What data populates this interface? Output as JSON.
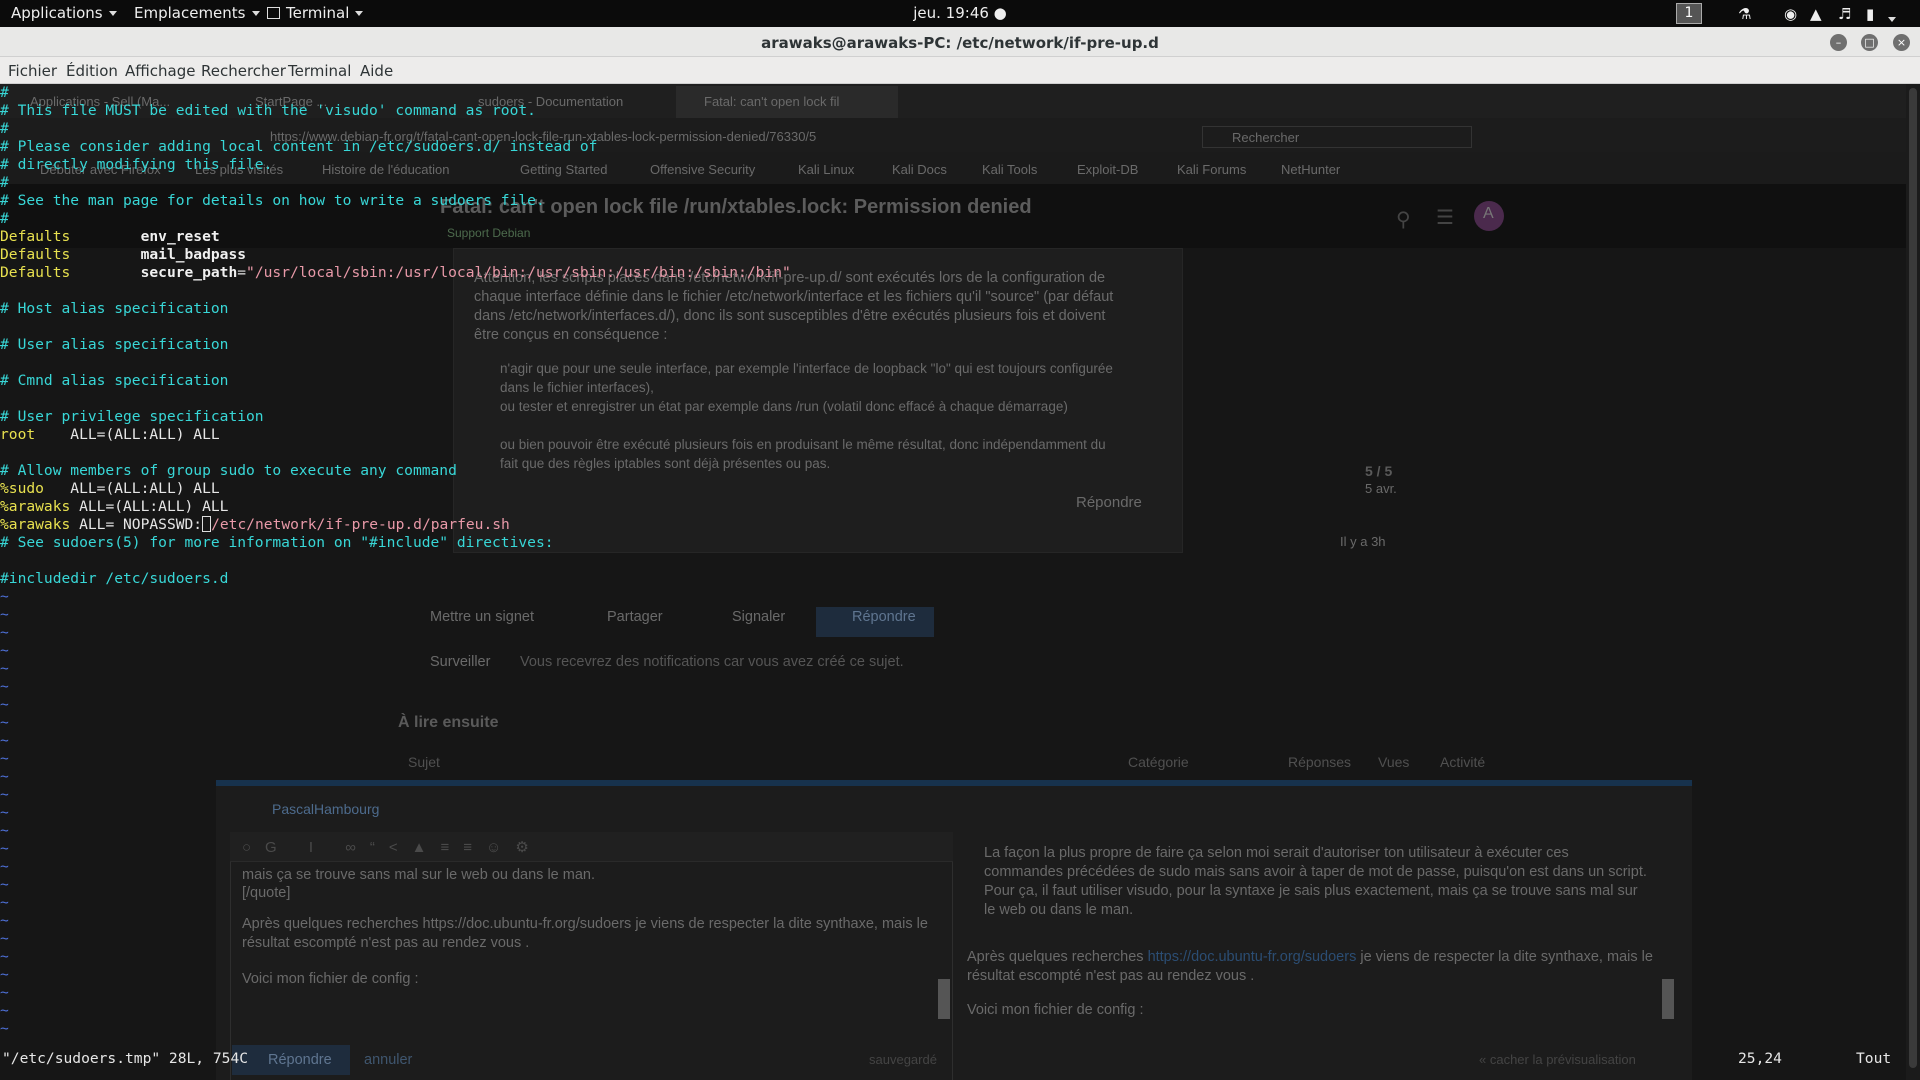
{
  "topbar": {
    "applications": "Applications",
    "places": "Emplacements",
    "terminal": "Terminal",
    "clock": "jeu. 19:46 ●",
    "workspace": "1",
    "icons": [
      "people-icon",
      "record-icon",
      "wifi-icon",
      "volume-icon",
      "battery-icon",
      "menu-caret-icon"
    ]
  },
  "window": {
    "title": "arawaks@arawaks-PC: /etc/network/if-pre-up.d",
    "menu": [
      "Fichier",
      "Édition",
      "Affichage",
      "Rechercher",
      "Terminal",
      "Aide"
    ]
  },
  "vim": {
    "lines": [
      [
        {
          "c": "cm",
          "t": "#"
        }
      ],
      [
        {
          "c": "cm",
          "t": "# This file MUST be edited with the 'visudo' command as root."
        }
      ],
      [
        {
          "c": "cm",
          "t": "#"
        }
      ],
      [
        {
          "c": "cm",
          "t": "# Please consider adding local content in /etc/sudoers.d/ instead of"
        }
      ],
      [
        {
          "c": "cm",
          "t": "# directly modifying this file."
        }
      ],
      [
        {
          "c": "cm",
          "t": "#"
        }
      ],
      [
        {
          "c": "cm",
          "t": "# See the man page for details on how to write a sudoers file."
        }
      ],
      [
        {
          "c": "cm",
          "t": "#"
        }
      ],
      [
        {
          "c": "kw",
          "t": "Defaults"
        },
        {
          "c": "",
          "t": "        "
        },
        {
          "c": "id",
          "t": "env_reset"
        }
      ],
      [
        {
          "c": "kw",
          "t": "Defaults"
        },
        {
          "c": "",
          "t": "        "
        },
        {
          "c": "id",
          "t": "mail_badpass"
        }
      ],
      [
        {
          "c": "kw",
          "t": "Defaults"
        },
        {
          "c": "",
          "t": "        "
        },
        {
          "c": "id",
          "t": "secure_path"
        },
        {
          "c": "",
          "t": "="
        },
        {
          "c": "st",
          "t": "\"/usr/local/sbin:/usr/local/bin:/usr/sbin:/usr/bin:/sbin:/bin\""
        }
      ],
      [
        {
          "c": "",
          "t": ""
        }
      ],
      [
        {
          "c": "cm",
          "t": "# Host alias specification"
        }
      ],
      [
        {
          "c": "",
          "t": ""
        }
      ],
      [
        {
          "c": "cm",
          "t": "# User alias specification"
        }
      ],
      [
        {
          "c": "",
          "t": ""
        }
      ],
      [
        {
          "c": "cm",
          "t": "# Cmnd alias specification"
        }
      ],
      [
        {
          "c": "",
          "t": ""
        }
      ],
      [
        {
          "c": "cm",
          "t": "# User privilege specification"
        }
      ],
      [
        {
          "c": "ps",
          "t": "root"
        },
        {
          "c": "",
          "t": "    ALL=(ALL:ALL) ALL"
        }
      ],
      [
        {
          "c": "",
          "t": ""
        }
      ],
      [
        {
          "c": "cm",
          "t": "# Allow members of group sudo to execute any command"
        }
      ],
      [
        {
          "c": "ps",
          "t": "%sudo"
        },
        {
          "c": "",
          "t": "   ALL=(ALL:ALL) ALL"
        }
      ],
      [
        {
          "c": "ps",
          "t": "%arawaks"
        },
        {
          "c": "",
          "t": " ALL=(ALL:ALL) ALL"
        }
      ],
      [
        {
          "c": "ps",
          "t": "%arawaks"
        },
        {
          "c": "",
          "t": " ALL= NOPASSWD:"
        },
        {
          "c": "cursor",
          "t": ""
        },
        {
          "c": "st",
          "t": "/etc/network/if-pre-up.d/parfeu.sh"
        }
      ],
      [
        {
          "c": "cm",
          "t": "# See sudoers(5) for more information on \"#include\" directives:"
        }
      ],
      [
        {
          "c": "",
          "t": ""
        }
      ],
      [
        {
          "c": "cm",
          "t": "#includedir /etc/sudoers.d"
        }
      ]
    ],
    "tilde": "~",
    "tilde_count": 25,
    "status_file": "\"/etc/sudoers.tmp\" 28L, 754C",
    "status_pos": "25,24",
    "status_scroll": "Tout"
  },
  "ghost": {
    "tabs": [
      "Applications - Sell (Ma...",
      "StartPage ...",
      "sudoers - Documentation",
      "Fatal: can't open lock fil"
    ],
    "url": "https://www.debian-fr.org/t/fatal-cant-open-lock-file-run-xtables-lock-permission-denied/76330/5",
    "search_placeholder": "Rechercher",
    "bookmarks": [
      "Débuter avec Firefox",
      "Les plus visités",
      "Histoire de l'éducation",
      "Getting Started",
      "Offensive Security",
      "Kali Linux",
      "Kali Docs",
      "Kali Tools",
      "Exploit-DB",
      "Kali Forums",
      "NetHunter"
    ],
    "topic_title": "Fatal: can't open lock file /run/xtables.lock: Permission denied",
    "category": "Support Debian",
    "avatar_letter": "A",
    "post_paragraph": "Attention, les scripts placés dans /etc/network/if-pre-up.d/ sont exécutés lors de la configuration de chaque interface définie dans le fichier /etc/network/interface et les fichiers qu'il \"source\" (par défaut dans /etc/network/interfaces.d/), donc ils sont susceptibles d'être exécutés plusieurs fois et doivent être conçus en conséquence :",
    "bullets": [
      "n'agir que pour une seule interface, par exemple l'interface de loopback \"lo\" qui est toujours configurée dans le fichier interfaces),",
      "ou tester et enregistrer un état par exemple dans /run (volatil donc effacé à chaque démarrage)",
      "ou bien pouvoir être exécuté plusieurs fois en produisant le même résultat, donc indépendamment du fait que des règles iptables sont déjà présentes ou pas."
    ],
    "reply_label": "Répondre",
    "progress": "5 / 5",
    "progress_date": "5 avr.",
    "ago": "Il y a 3h",
    "actions": [
      "Mettre un signet",
      "Partager",
      "Signaler",
      "Répondre"
    ],
    "watch_label": "Surveiller",
    "watch_text": "Vous recevrez des notifications car vous avez créé ce sujet.",
    "next_heading": "À lire ensuite",
    "next_cols": [
      "Sujet",
      "Catégorie",
      "Réponses",
      "Vues",
      "Activité"
    ],
    "compose_user": "PascalHambourg",
    "compose_lines": [
      "mais ça se trouve sans mal sur le web ou dans le man.",
      "[/quote]",
      "",
      " Après quelques recherches https://doc.ubuntu-fr.org/sudoers je viens de respecter la dite synthaxe, mais le résultat escompté n'est pas au rendez vous .",
      "",
      "Voici mon fichier de config :"
    ],
    "preview_quote": "La façon la plus propre de faire ça selon moi serait d'autoriser ton utilisateur à exécuter ces commandes précédées de sudo mais sans avoir à taper de mot de passe, puisqu'on est dans un script. Pour ça, il faut utiliser visudo, pour la syntaxe je sais plus exactement, mais ça se trouve sans mal sur le web ou dans le man.",
    "preview_p1_pre": "Après quelques recherches ",
    "preview_link": "https://doc.ubuntu-fr.org/sudoers",
    "preview_p1_post": " je viens de respecter la dite synthaxe, mais le résultat escompté n'est pas au rendez vous .",
    "preview_p2": "Voici mon fichier de config :",
    "save_btn": "Répondre",
    "cancel": "annuler",
    "saved": "sauvegardé",
    "hide_preview": "« cacher la prévisualisation"
  }
}
